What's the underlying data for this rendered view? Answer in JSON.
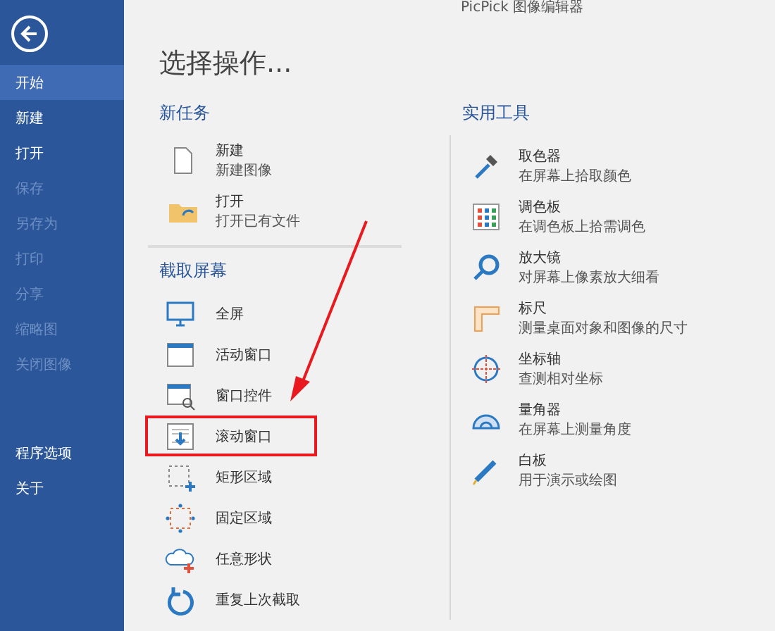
{
  "app_title": "PicPick 图像编辑器",
  "sidebar": {
    "items": [
      {
        "label": "开始",
        "selected": true,
        "disabled": false
      },
      {
        "label": "新建",
        "selected": false,
        "disabled": false
      },
      {
        "label": "打开",
        "selected": false,
        "disabled": false
      },
      {
        "label": "保存",
        "selected": false,
        "disabled": true
      },
      {
        "label": "另存为",
        "selected": false,
        "disabled": true
      },
      {
        "label": "打印",
        "selected": false,
        "disabled": true
      },
      {
        "label": "分享",
        "selected": false,
        "disabled": true
      },
      {
        "label": "缩略图",
        "selected": false,
        "disabled": true
      },
      {
        "label": "关闭图像",
        "selected": false,
        "disabled": true
      }
    ],
    "bottom_items": [
      {
        "label": "程序选项",
        "selected": false
      },
      {
        "label": "关于",
        "selected": false
      }
    ]
  },
  "heading": "选择操作...",
  "new_task": {
    "title": "新任务",
    "items": [
      {
        "label": "新建",
        "description": "新建图像"
      },
      {
        "label": "打开",
        "description": "打开已有文件"
      }
    ]
  },
  "capture": {
    "title": "截取屏幕",
    "items": [
      {
        "label": "全屏",
        "highlighted": false
      },
      {
        "label": "活动窗口",
        "highlighted": false
      },
      {
        "label": "窗口控件",
        "highlighted": false
      },
      {
        "label": "滚动窗口",
        "highlighted": true
      },
      {
        "label": "矩形区域",
        "highlighted": false
      },
      {
        "label": "固定区域",
        "highlighted": false
      },
      {
        "label": "任意形状",
        "highlighted": false
      },
      {
        "label": "重复上次截取",
        "highlighted": false
      }
    ]
  },
  "tools": {
    "title": "实用工具",
    "items": [
      {
        "label": "取色器",
        "description": "在屏幕上拾取颜色"
      },
      {
        "label": "调色板",
        "description": "在调色板上拾需调色"
      },
      {
        "label": "放大镜",
        "description": "对屏幕上像素放大细看"
      },
      {
        "label": "标尺",
        "description": "测量桌面对象和图像的尺寸"
      },
      {
        "label": "坐标轴",
        "description": "查测相对坐标"
      },
      {
        "label": "量角器",
        "description": "在屏幕上测量角度"
      },
      {
        "label": "白板",
        "description": "用于演示或绘图"
      }
    ]
  }
}
